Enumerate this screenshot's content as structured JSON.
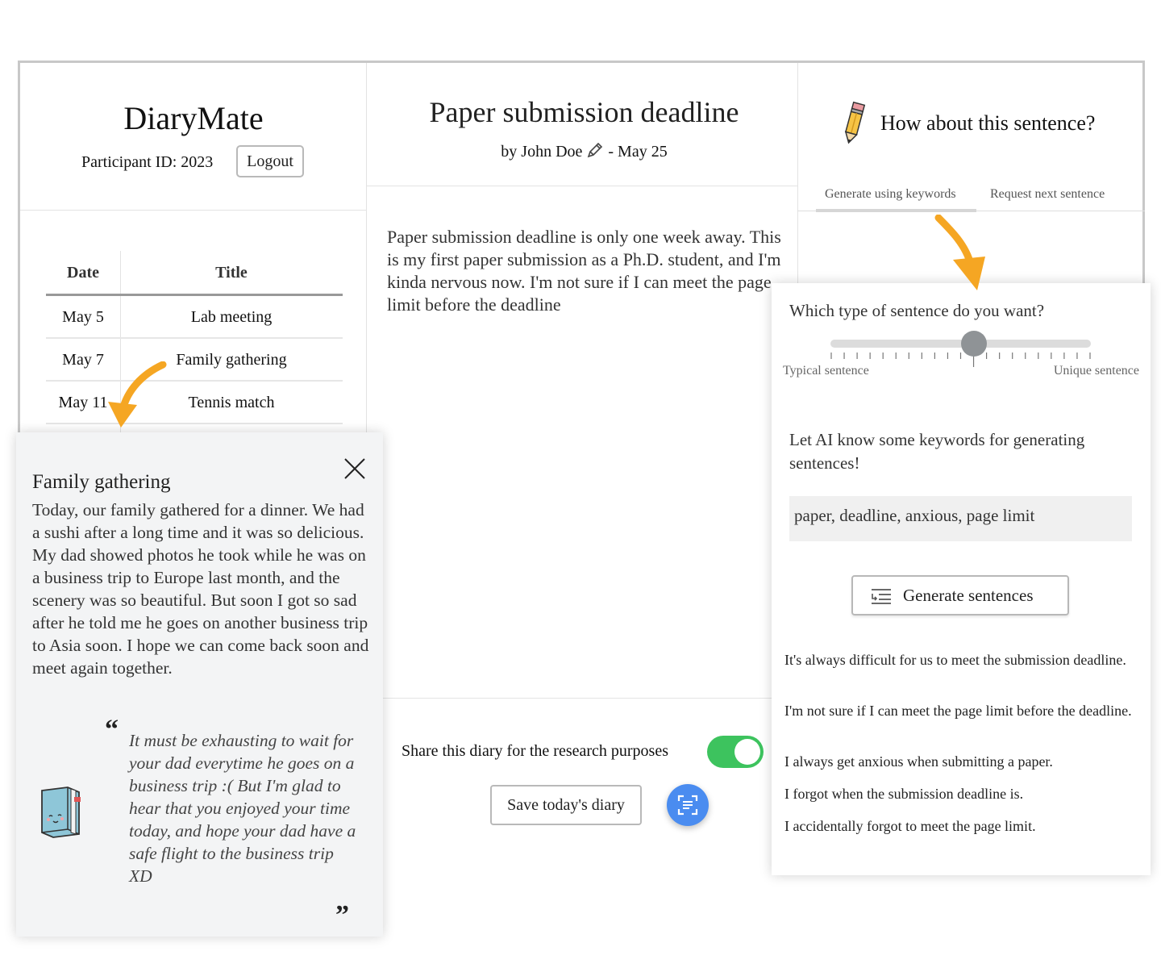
{
  "app": {
    "name": "DiaryMate",
    "participant_label": "Participant ID: 2023",
    "logout_label": "Logout"
  },
  "diary_list": {
    "headers": {
      "date": "Date",
      "title": "Title"
    },
    "rows": [
      {
        "date": "May 5",
        "title": "Lab meeting"
      },
      {
        "date": "May 7",
        "title": "Family gathering"
      },
      {
        "date": "May 11",
        "title": "Tennis match"
      }
    ]
  },
  "entry": {
    "title": "Paper submission deadline",
    "by": "by John Doe",
    "date": "- May 25",
    "body": "Paper submission deadline is only one week away. This is my first paper submission as a Ph.D. student, and I'm kinda nervous now. I'm not sure if I can meet the page limit before the deadline",
    "share_label": "Share this diary for the research purposes",
    "share_enabled": true,
    "save_label": "Save today's diary"
  },
  "assistant": {
    "heading": "How about this sentence?",
    "tabs": [
      {
        "label": "Generate using keywords",
        "active": true
      },
      {
        "label": "Request next sentence",
        "active": false
      }
    ],
    "question": "Which type of sentence do you want?",
    "slider": {
      "value": 0.55,
      "left_label": "Typical sentence",
      "right_label": "Unique sentence"
    },
    "keywords_prompt": "Let AI know some keywords for generating sentences!",
    "keywords_value": "paper, deadline, anxious, page limit",
    "generate_label": "Generate sentences",
    "suggestions": [
      "It's always difficult for us to meet the submission deadline.",
      "I'm not sure if I can meet the page limit before the deadline.",
      "I always get anxious when submitting a paper.",
      "I forgot when the submission deadline is.",
      "I accidentally forgot to meet the page limit."
    ]
  },
  "popup": {
    "title": "Family gathering",
    "close_label": "X",
    "body": "Today, our family gathered for a dinner. We had a sushi after a long time and it was so delicious. My dad showed photos he took while he was on a business trip to Europe last month, and the scenery was so beautiful. But soon I got so sad after he told me he goes on another business trip to Asia soon. I hope we can come back soon and meet again together.",
    "quote_open": "“",
    "quote_close": "”",
    "reply": "It must be exhausting to wait for your dad everytime he goes on a business trip :( But I'm glad to hear that you enjoyed your time today, and hope your dad have a safe flight to the business trip XD"
  },
  "colors": {
    "toggle_on": "#3dc35e",
    "scan_button": "#4a8cf0",
    "arrow": "#f5a623",
    "popup_bg": "#f3f4f5"
  },
  "icons": [
    "pencil-icon",
    "scan-icon",
    "generate-icon",
    "close-icon",
    "diary-book-icon"
  ]
}
